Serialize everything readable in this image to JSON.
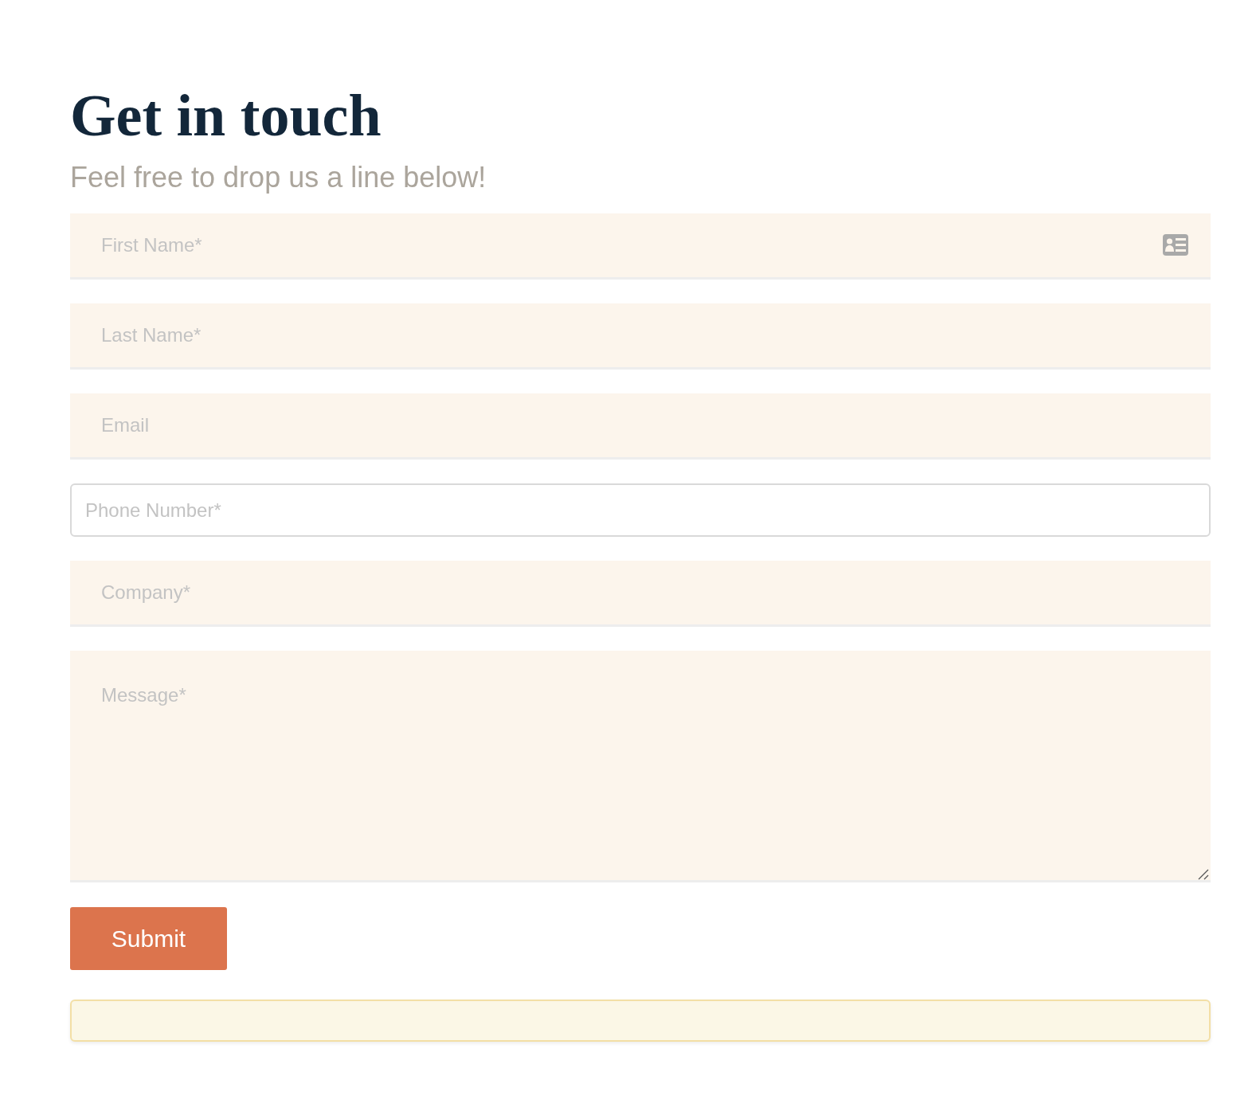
{
  "heading": "Get in touch",
  "subheading": "Feel free to drop us a line below!",
  "fields": [
    {
      "kind": "filled",
      "placeholder": "First Name*",
      "autofill_icon": true
    },
    {
      "kind": "filled",
      "placeholder": "Last Name*",
      "autofill_icon": false
    },
    {
      "kind": "filled",
      "placeholder": "Email",
      "autofill_icon": false
    },
    {
      "kind": "outlined",
      "placeholder": "Phone Number*",
      "autofill_icon": false
    },
    {
      "kind": "filled",
      "placeholder": "Company*",
      "autofill_icon": false
    },
    {
      "kind": "textarea",
      "placeholder": "Message*",
      "autofill_icon": false
    }
  ],
  "submit": {
    "label": "Submit"
  }
}
